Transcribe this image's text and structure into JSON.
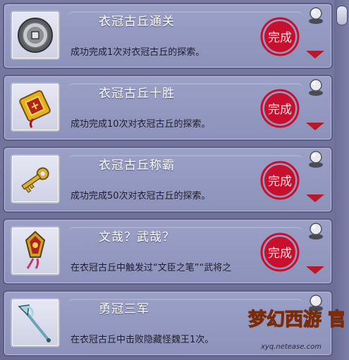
{
  "achievements": [
    {
      "title": "衣冠古丘通关",
      "description": "成功完成1次对衣冠古丘的探索。",
      "icon": "coin-icon",
      "completed": true,
      "stamp_text": "完成"
    },
    {
      "title": "衣冠古丘十胜",
      "description": "成功完成10次对衣冠古丘的探索。",
      "icon": "gold-token-icon",
      "completed": true,
      "stamp_text": "完成"
    },
    {
      "title": "衣冠古丘称霸",
      "description": "成功完成50次对衣冠古丘的探索。",
      "icon": "key-icon",
      "completed": true,
      "stamp_text": "完成"
    },
    {
      "title": "文哉？武哉？",
      "description": "在衣冠古丘中触发过“文臣之笔”“武将之",
      "icon": "tasseled-plaque-icon",
      "completed": true,
      "stamp_text": "完成"
    },
    {
      "title": "勇冠三军",
      "description": "在衣冠古丘中击败隐藏怪魏王1次。",
      "icon": "halberd-icon",
      "completed": false,
      "stamp_text": ""
    }
  ],
  "watermark": {
    "logo_text": "梦幻西游 官方",
    "url": "xyq.netease.com"
  },
  "colors": {
    "seal_red": "#c8102e",
    "arrow_red": "#b5192a",
    "panel": "#9aa0c6"
  }
}
